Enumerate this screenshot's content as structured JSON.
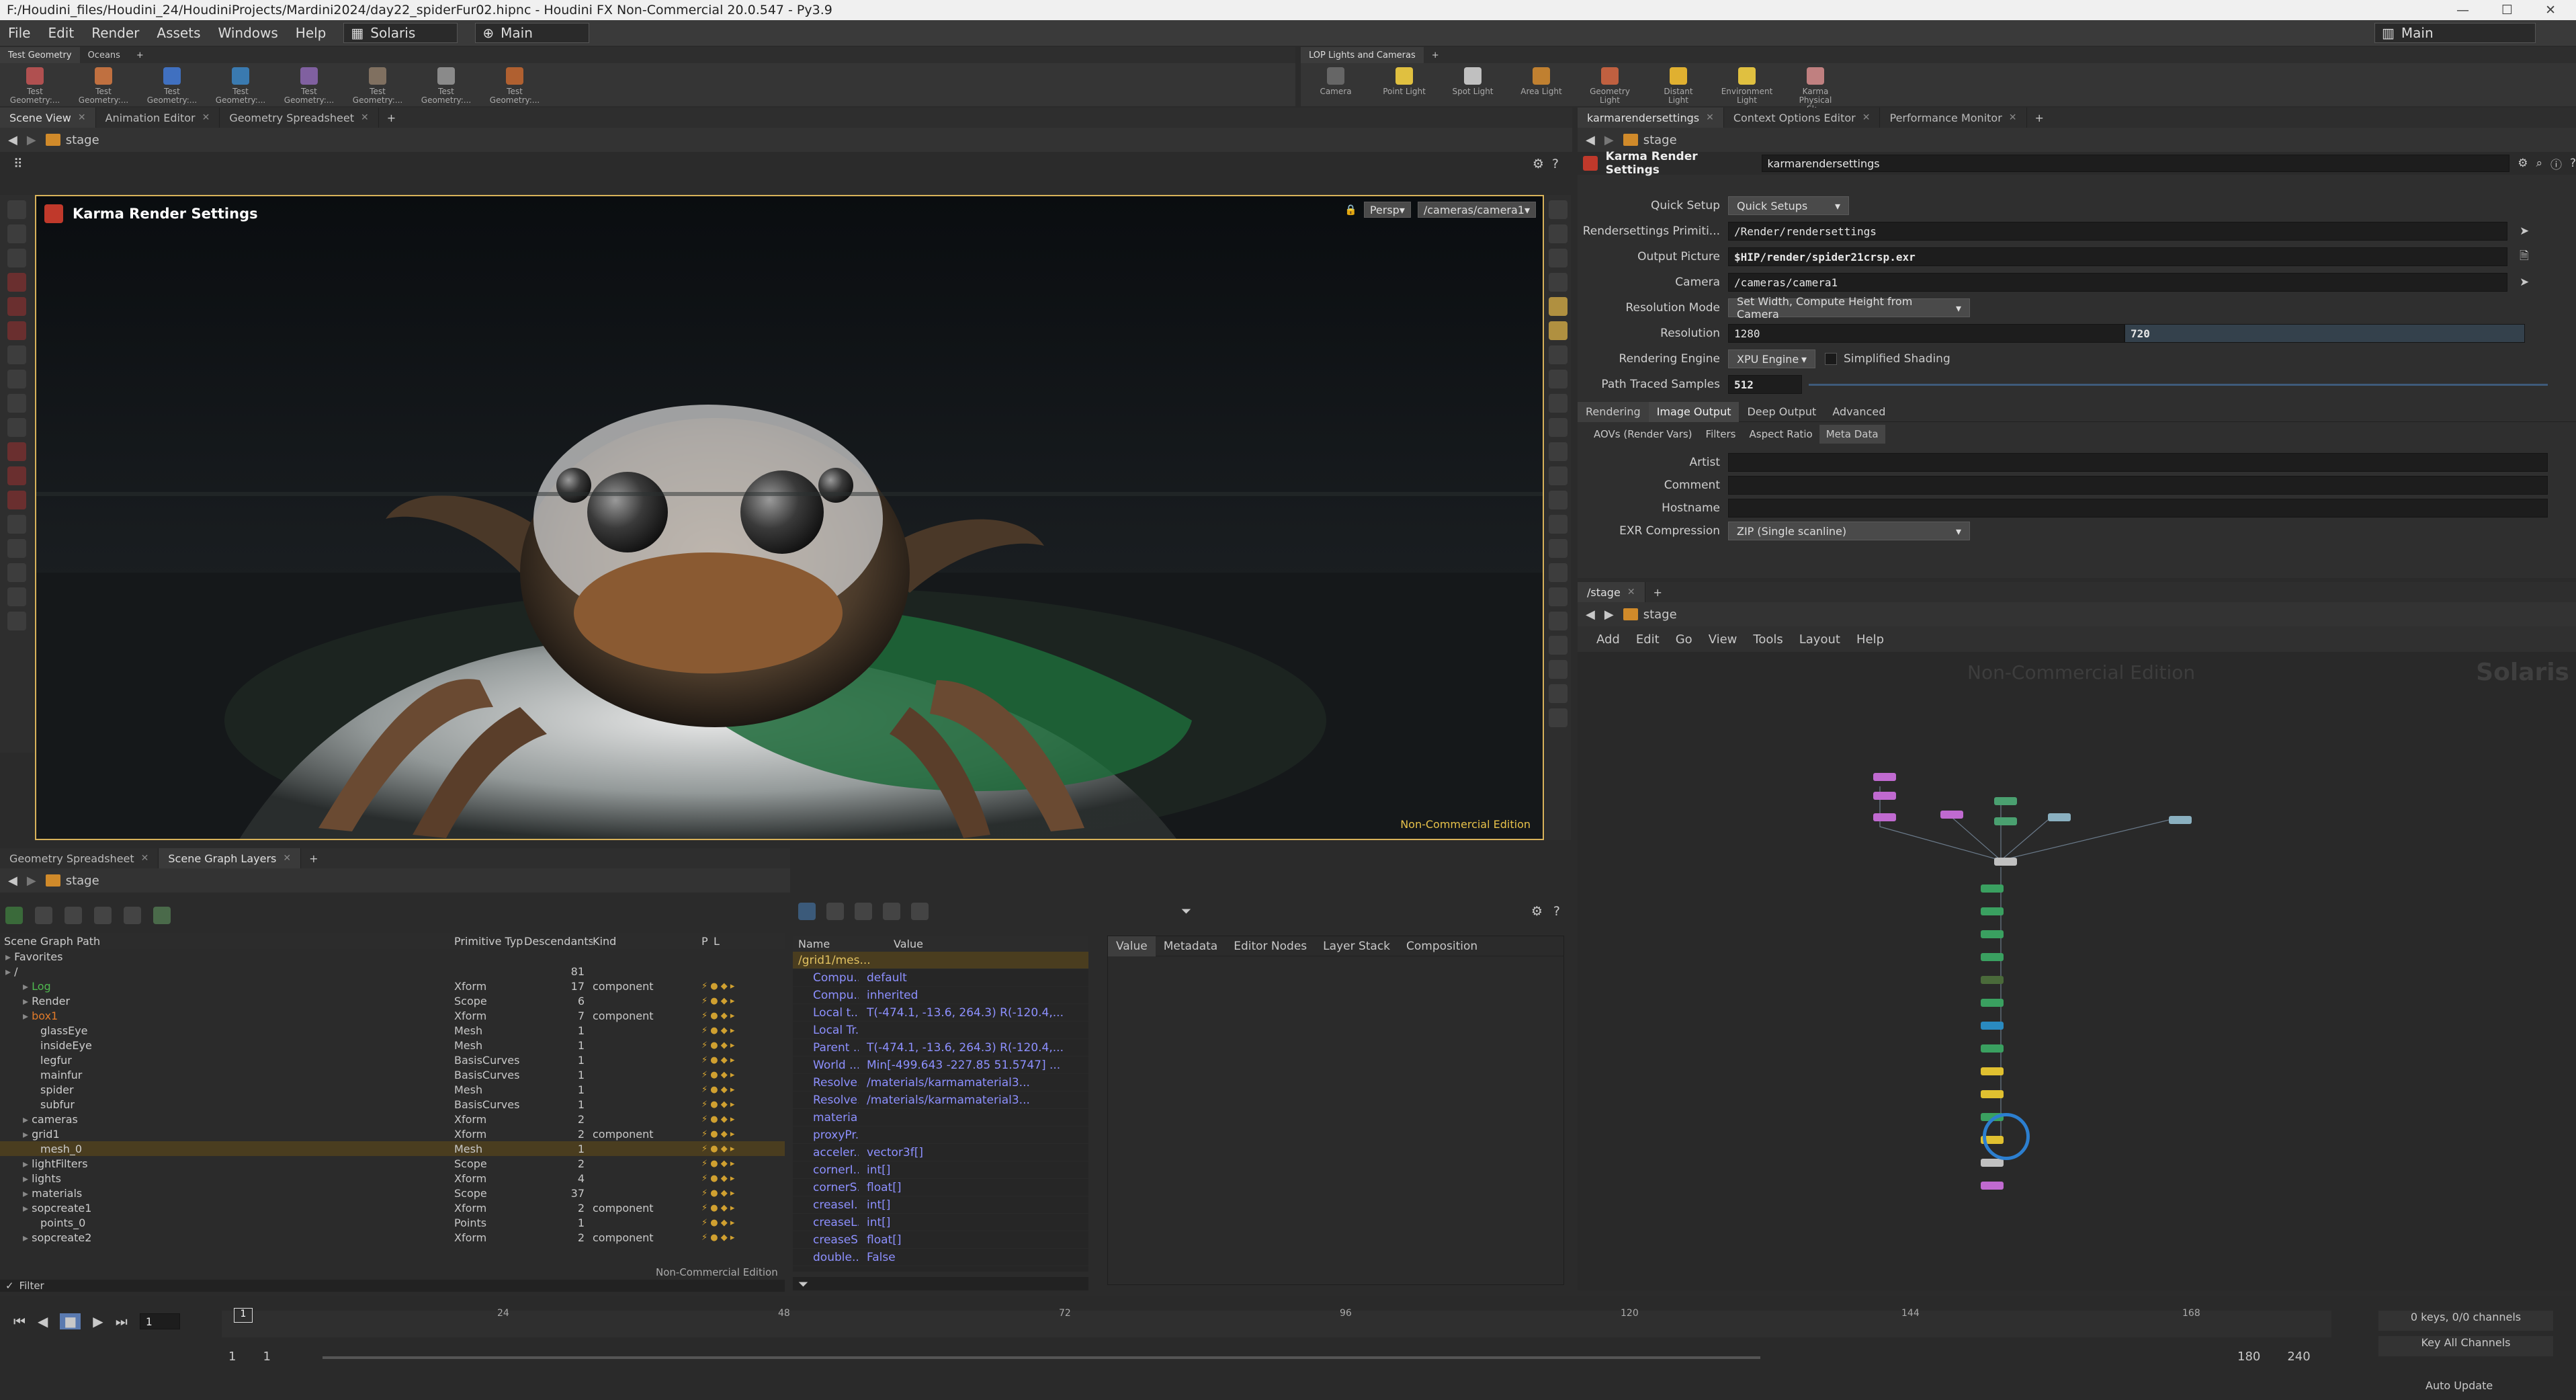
{
  "window": {
    "title": "F:/Houdini_files/Houdini_24/HoudiniProjects/Mardini2024/day22_spiderFur02.hipnc - Houdini FX Non-Commercial 20.0.547 - Py3.9"
  },
  "menu": {
    "items": [
      "File",
      "Edit",
      "Render",
      "Assets",
      "Windows",
      "Help"
    ],
    "desktop": "Solaris",
    "main_sel": "Main",
    "right_main": "Main"
  },
  "shelf_left": {
    "tabs": [
      "Test Geometry",
      "Oceans"
    ],
    "tools": [
      "Test Geometry:...",
      "Test Geometry:...",
      "Test Geometry:...",
      "Test Geometry:...",
      "Test Geometry:...",
      "Test Geometry:...",
      "Test Geometry:...",
      "Test Geometry:..."
    ]
  },
  "shelf_right": {
    "tabs": [
      "LOP Lights and Cameras"
    ],
    "tools": [
      "Camera",
      "Point Light",
      "Spot Light",
      "Area Light",
      "Geometry Light",
      "Distant Light",
      "Environment Light",
      "Karma Physical Sk..."
    ]
  },
  "viewer": {
    "tabs": [
      "Scene View",
      "Animation Editor",
      "Geometry Spreadsheet"
    ],
    "path": "stage",
    "node_title": "Karma Render Settings",
    "persp": "Persp",
    "camera": "/cameras/camera1",
    "watermark": "Non-Commercial Edition"
  },
  "params": {
    "tabs": [
      "karmarendersettings",
      "Context Options Editor",
      "Performance Monitor"
    ],
    "path": "stage",
    "node_type": "Karma Render Settings",
    "node_name": "karmarendersettings",
    "quick_setup_label": "Quick Setup",
    "quick_setup_value": "Quick Setups",
    "rs_prim_label": "Rendersettings Primiti...",
    "rs_prim_value": "/Render/rendersettings",
    "output_label": "Output Picture",
    "output_value": "$HIP/render/spider21crsp.exr",
    "camera_label": "Camera",
    "camera_value": "/cameras/camera1",
    "resmode_label": "Resolution Mode",
    "resmode_value": "Set Width, Compute Height from Camera",
    "res_label": "Resolution",
    "res_w": "1280",
    "res_h": "720",
    "engine_label": "Rendering Engine",
    "engine_value": "XPU Engine",
    "simplified": "Simplified Shading",
    "samples_label": "Path Traced Samples",
    "samples_value": "512",
    "tabs2": [
      "Rendering",
      "Image Output",
      "Deep Output",
      "Advanced"
    ],
    "tabs3": [
      "AOVs (Render Vars)",
      "Filters",
      "Aspect Ratio",
      "Meta Data"
    ],
    "artist_label": "Artist",
    "comment_label": "Comment",
    "hostname_label": "Hostname",
    "exr_label": "EXR Compression",
    "exr_value": "ZIP (Single scanline)"
  },
  "network": {
    "tab": "/stage",
    "path": "stage",
    "menu": [
      "Add",
      "Edit",
      "Go",
      "View",
      "Tools",
      "Layout",
      "Help"
    ],
    "watermark": "Non-Commercial Edition",
    "context": "Solaris"
  },
  "sgtree": {
    "tabs": [
      "Geometry Spreadsheet",
      "Scene Graph Layers"
    ],
    "path": "stage",
    "headers": [
      "Scene Graph Path",
      "Primitive Typ",
      "Descendants",
      "Kind",
      "P",
      "L"
    ],
    "rows": [
      {
        "indent": 0,
        "name": "Favorites",
        "type": "",
        "desc": "",
        "kind": "",
        "color": "#cccccc"
      },
      {
        "indent": 0,
        "name": "/",
        "type": "",
        "desc": "81",
        "kind": "",
        "color": "#cccccc"
      },
      {
        "indent": 1,
        "name": "Log",
        "type": "Xform",
        "desc": "17",
        "kind": "component",
        "color": "#4fb84f"
      },
      {
        "indent": 1,
        "name": "Render",
        "type": "Scope",
        "desc": "6",
        "kind": "",
        "color": "#cccccc"
      },
      {
        "indent": 1,
        "name": "box1",
        "type": "Xform",
        "desc": "7",
        "kind": "component",
        "color": "#e07a2a"
      },
      {
        "indent": 2,
        "name": "glassEye",
        "type": "Mesh",
        "desc": "1",
        "kind": "",
        "color": "#cccccc"
      },
      {
        "indent": 2,
        "name": "insideEye",
        "type": "Mesh",
        "desc": "1",
        "kind": "",
        "color": "#cccccc"
      },
      {
        "indent": 2,
        "name": "legfur",
        "type": "BasisCurves",
        "desc": "1",
        "kind": "",
        "color": "#cccccc"
      },
      {
        "indent": 2,
        "name": "mainfur",
        "type": "BasisCurves",
        "desc": "1",
        "kind": "",
        "color": "#cccccc"
      },
      {
        "indent": 2,
        "name": "spider",
        "type": "Mesh",
        "desc": "1",
        "kind": "",
        "color": "#cccccc"
      },
      {
        "indent": 2,
        "name": "subfur",
        "type": "BasisCurves",
        "desc": "1",
        "kind": "",
        "color": "#cccccc"
      },
      {
        "indent": 1,
        "name": "cameras",
        "type": "Xform",
        "desc": "2",
        "kind": "",
        "color": "#cccccc"
      },
      {
        "indent": 1,
        "name": "grid1",
        "type": "Xform",
        "desc": "2",
        "kind": "component",
        "color": "#cccccc"
      },
      {
        "indent": 2,
        "name": "mesh_0",
        "type": "Mesh",
        "desc": "1",
        "kind": "",
        "color": "#cccccc",
        "sel": true
      },
      {
        "indent": 1,
        "name": "lightFilters",
        "type": "Scope",
        "desc": "2",
        "kind": "",
        "color": "#cccccc"
      },
      {
        "indent": 1,
        "name": "lights",
        "type": "Xform",
        "desc": "4",
        "kind": "",
        "color": "#cccccc"
      },
      {
        "indent": 1,
        "name": "materials",
        "type": "Scope",
        "desc": "37",
        "kind": "",
        "color": "#cccccc"
      },
      {
        "indent": 1,
        "name": "sopcreate1",
        "type": "Xform",
        "desc": "2",
        "kind": "component",
        "color": "#cccccc"
      },
      {
        "indent": 2,
        "name": "points_0",
        "type": "Points",
        "desc": "1",
        "kind": "",
        "color": "#cccccc"
      },
      {
        "indent": 1,
        "name": "sopcreate2",
        "type": "Xform",
        "desc": "2",
        "kind": "component",
        "color": "#cccccc"
      }
    ],
    "watermark": "Non-Commercial Edition",
    "filter": "Filter"
  },
  "props": {
    "headers": [
      "Name",
      "Value"
    ],
    "root": "/grid1/mes...",
    "rows": [
      {
        "n": "Compu...",
        "v": "default"
      },
      {
        "n": "Compu...",
        "v": "inherited"
      },
      {
        "n": "Local t...",
        "v": "T(-474.1, -13.6, 264.3) R(-120.4,..."
      },
      {
        "n": "Local Tr...",
        "v": ""
      },
      {
        "n": "Parent ...",
        "v": "T(-474.1, -13.6, 264.3) R(-120.4,..."
      },
      {
        "n": "World ...",
        "v": "Min[-499.643 -227.85 51.5747] ..."
      },
      {
        "n": "Resolve...",
        "v": "/materials/karmamaterial3..."
      },
      {
        "n": "Resolve...",
        "v": "/materials/karmamaterial3..."
      },
      {
        "n": "materia...",
        "v": ""
      },
      {
        "n": "proxyPr...",
        "v": ""
      },
      {
        "n": "acceler...",
        "v": "vector3f[]"
      },
      {
        "n": "cornerI...",
        "v": "int[]"
      },
      {
        "n": "cornerS...",
        "v": "float[]"
      },
      {
        "n": "creaseI...",
        "v": "int[]"
      },
      {
        "n": "creaseL...",
        "v": "int[]"
      },
      {
        "n": "creaseS...",
        "v": "float[]"
      },
      {
        "n": "double...",
        "v": "False"
      }
    ],
    "tabs": [
      "Value",
      "Metadata",
      "Editor Nodes",
      "Layer Stack",
      "Composition"
    ]
  },
  "timeline": {
    "frame": "1",
    "start": "1",
    "start2": "1",
    "end": "180",
    "end2": "240",
    "ticks": [
      "24",
      "48",
      "72",
      "96",
      "120",
      "144",
      "168"
    ],
    "keys": "0 keys, 0/0 channels",
    "keyall": "Key All Channels",
    "auto": "Auto Update"
  }
}
